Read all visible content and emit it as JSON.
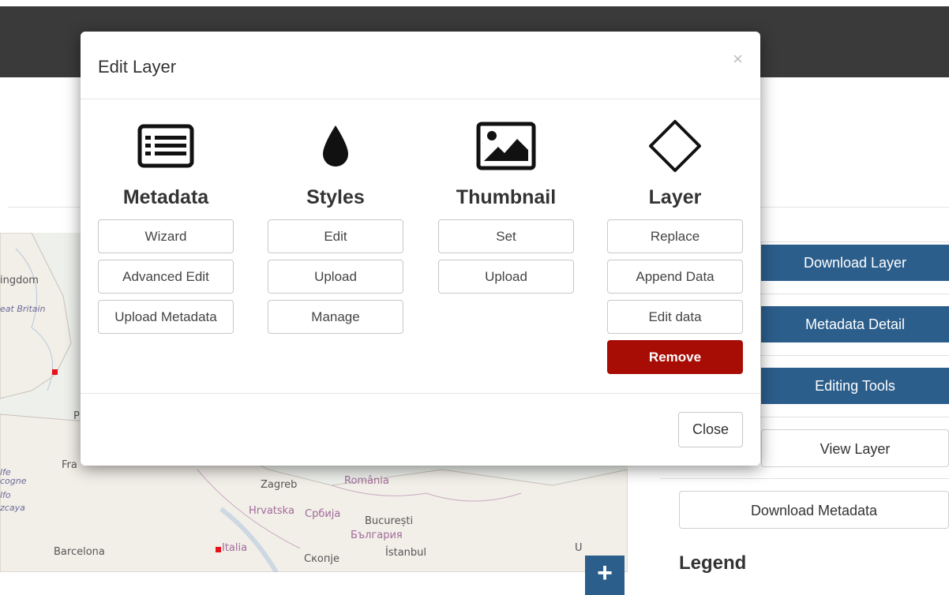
{
  "modal": {
    "title": "Edit Layer",
    "close_x": "×",
    "close_button": "Close",
    "columns": [
      {
        "heading": "Metadata",
        "icon": "list-icon",
        "buttons": [
          "Wizard",
          "Advanced Edit",
          "Upload Metadata"
        ]
      },
      {
        "heading": "Styles",
        "icon": "drop-icon",
        "buttons": [
          "Edit",
          "Upload",
          "Manage"
        ]
      },
      {
        "heading": "Thumbnail",
        "icon": "image-icon",
        "buttons": [
          "Set",
          "Upload"
        ]
      },
      {
        "heading": "Layer",
        "icon": "diamond-icon",
        "buttons": [
          "Replace",
          "Append Data",
          "Edit data"
        ],
        "danger_button": "Remove"
      }
    ]
  },
  "sidebar": {
    "download_layer": "Download Layer",
    "metadata_detail": "Metadata Detail",
    "editing_tools": "Editing Tools",
    "view_layer": "View Layer",
    "download_metadata": "Download Metadata",
    "legend": "Legend"
  },
  "map": {
    "zoom_in": "+",
    "labels": [
      "ingdom",
      "eat Britain",
      "Fra",
      "P",
      "Zagreb",
      "România",
      "Hrvatska",
      "Србија",
      "București",
      "България",
      "Barcelona",
      "Italia",
      "Скопје",
      "İstanbul",
      "U",
      "lfe",
      "cogne",
      "lfo",
      "zcaya"
    ]
  },
  "colors": {
    "primary": "#2c5e8c",
    "danger": "#a80d05",
    "topbar": "#3a3a3a"
  }
}
